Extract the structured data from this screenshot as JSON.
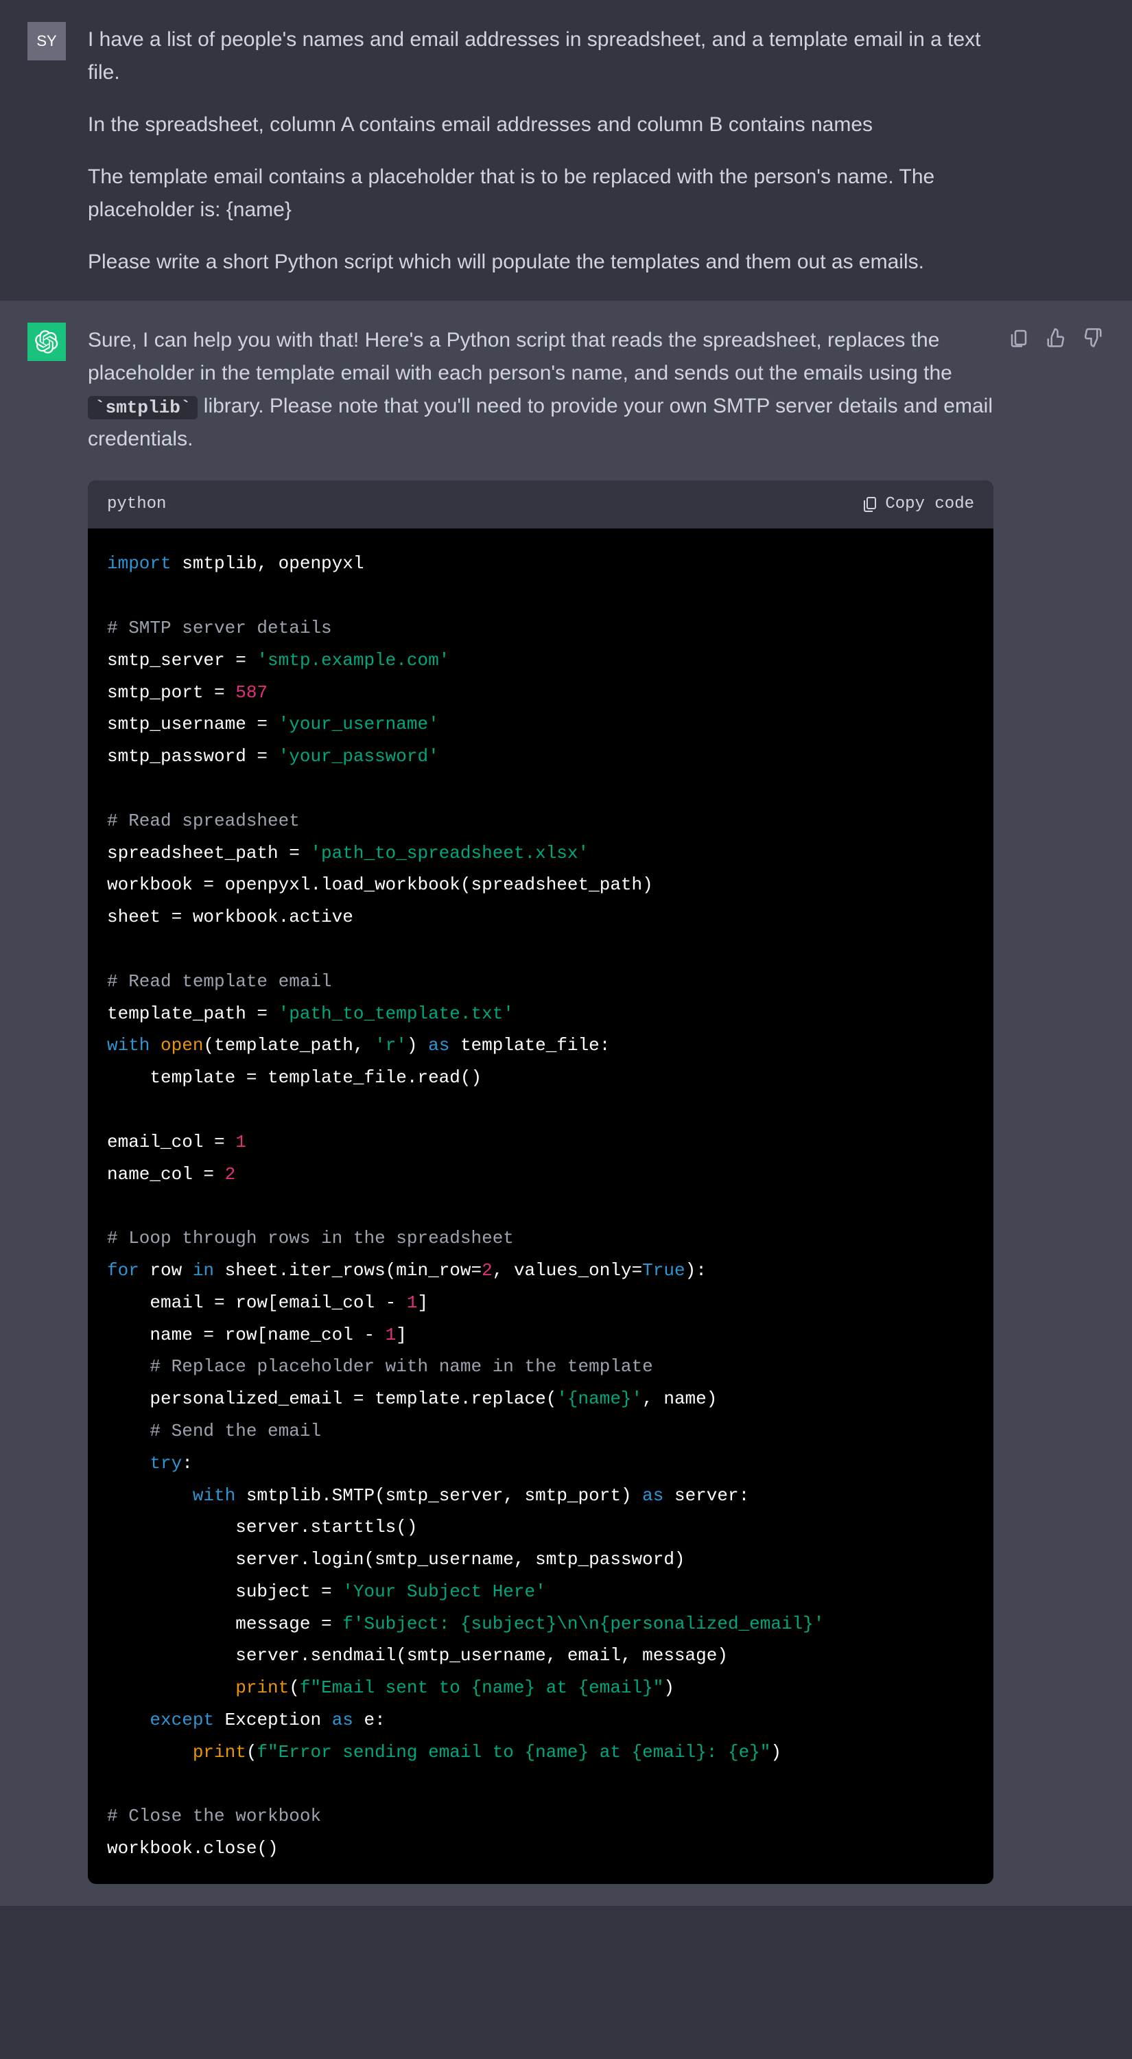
{
  "user": {
    "avatar_initials": "SY",
    "paragraphs": [
      "I have a list of people's names and email addresses in spreadsheet, and a template email in a text file.",
      "In the spreadsheet, column A contains email addresses and column B contains names",
      "The template email contains a placeholder that is to be replaced with the person's name. The placeholder is: {name}",
      "Please write a short Python script which will populate the templates and them out as emails."
    ]
  },
  "assistant": {
    "intro_prefix": "Sure, I can help you with that! Here's a Python script that reads the spreadsheet, replaces the placeholder in the template email with each person's name, and sends out the emails using the ",
    "intro_code": "`smtplib`",
    "intro_suffix": " library. Please note that you'll need to provide your own SMTP server details and email credentials.",
    "code_lang": "python",
    "copy_label": "Copy code",
    "code_tokens": [
      [
        [
          "kw",
          "import"
        ],
        [
          "var",
          " smtplib, openpyxl"
        ]
      ],
      [],
      [
        [
          "cm",
          "# SMTP server details"
        ]
      ],
      [
        [
          "var",
          "smtp_server = "
        ],
        [
          "str",
          "'smtp.example.com'"
        ]
      ],
      [
        [
          "var",
          "smtp_port = "
        ],
        [
          "num",
          "587"
        ]
      ],
      [
        [
          "var",
          "smtp_username = "
        ],
        [
          "str",
          "'your_username'"
        ]
      ],
      [
        [
          "var",
          "smtp_password = "
        ],
        [
          "str",
          "'your_password'"
        ]
      ],
      [],
      [
        [
          "cm",
          "# Read spreadsheet"
        ]
      ],
      [
        [
          "var",
          "spreadsheet_path = "
        ],
        [
          "str",
          "'path_to_spreadsheet.xlsx'"
        ]
      ],
      [
        [
          "var",
          "workbook = openpyxl.load_workbook(spreadsheet_path)"
        ]
      ],
      [
        [
          "var",
          "sheet = workbook.active"
        ]
      ],
      [],
      [
        [
          "cm",
          "# Read template email"
        ]
      ],
      [
        [
          "var",
          "template_path = "
        ],
        [
          "str",
          "'path_to_template.txt'"
        ]
      ],
      [
        [
          "kw",
          "with"
        ],
        [
          "var",
          " "
        ],
        [
          "fn",
          "open"
        ],
        [
          "var",
          "(template_path, "
        ],
        [
          "str",
          "'r'"
        ],
        [
          "var",
          ") "
        ],
        [
          "kw",
          "as"
        ],
        [
          "var",
          " template_file:"
        ]
      ],
      [
        [
          "var",
          "    template = template_file.read()"
        ]
      ],
      [],
      [
        [
          "var",
          "email_col = "
        ],
        [
          "num",
          "1"
        ]
      ],
      [
        [
          "var",
          "name_col = "
        ],
        [
          "num",
          "2"
        ]
      ],
      [],
      [
        [
          "cm",
          "# Loop through rows in the spreadsheet"
        ]
      ],
      [
        [
          "kw",
          "for"
        ],
        [
          "var",
          " row "
        ],
        [
          "kw",
          "in"
        ],
        [
          "var",
          " sheet.iter_rows(min_row="
        ],
        [
          "num",
          "2"
        ],
        [
          "var",
          ", values_only="
        ],
        [
          "bool",
          "True"
        ],
        [
          "var",
          "):"
        ]
      ],
      [
        [
          "var",
          "    email = row[email_col - "
        ],
        [
          "num",
          "1"
        ],
        [
          "var",
          "]"
        ]
      ],
      [
        [
          "var",
          "    name = row[name_col - "
        ],
        [
          "num",
          "1"
        ],
        [
          "var",
          "]"
        ]
      ],
      [
        [
          "var",
          "    "
        ],
        [
          "cm",
          "# Replace placeholder with name in the template"
        ]
      ],
      [
        [
          "var",
          "    personalized_email = template.replace("
        ],
        [
          "str",
          "'{name}'"
        ],
        [
          "var",
          ", name)"
        ]
      ],
      [
        [
          "var",
          "    "
        ],
        [
          "cm",
          "# Send the email"
        ]
      ],
      [
        [
          "var",
          "    "
        ],
        [
          "kw",
          "try"
        ],
        [
          "var",
          ":"
        ]
      ],
      [
        [
          "var",
          "        "
        ],
        [
          "kw",
          "with"
        ],
        [
          "var",
          " smtplib.SMTP(smtp_server, smtp_port) "
        ],
        [
          "kw",
          "as"
        ],
        [
          "var",
          " server:"
        ]
      ],
      [
        [
          "var",
          "            server.starttls()"
        ]
      ],
      [
        [
          "var",
          "            server.login(smtp_username, smtp_password)"
        ]
      ],
      [
        [
          "var",
          "            subject = "
        ],
        [
          "str",
          "'Your Subject Here'"
        ]
      ],
      [
        [
          "var",
          "            message = "
        ],
        [
          "fstr",
          "f'Subject: {subject}\\n\\n{personalized_email}'"
        ]
      ],
      [
        [
          "var",
          "            server.sendmail(smtp_username, email, message)"
        ]
      ],
      [
        [
          "var",
          "            "
        ],
        [
          "fn",
          "print"
        ],
        [
          "var",
          "("
        ],
        [
          "fstr",
          "f\"Email sent to {name} at {email}\""
        ],
        [
          "var",
          ")"
        ]
      ],
      [
        [
          "var",
          "    "
        ],
        [
          "kw",
          "except"
        ],
        [
          "var",
          " Exception "
        ],
        [
          "kw",
          "as"
        ],
        [
          "var",
          " e:"
        ]
      ],
      [
        [
          "var",
          "        "
        ],
        [
          "fn",
          "print"
        ],
        [
          "var",
          "("
        ],
        [
          "fstr",
          "f\"Error sending email to {name} at {email}: {e}\""
        ],
        [
          "var",
          ")"
        ]
      ],
      [],
      [
        [
          "cm",
          "# Close the workbook"
        ]
      ],
      [
        [
          "var",
          "workbook.close()"
        ]
      ]
    ]
  },
  "icons": {
    "clipboard": "clipboard-icon",
    "thumbs_up": "thumbs-up-icon",
    "thumbs_down": "thumbs-down-icon"
  }
}
